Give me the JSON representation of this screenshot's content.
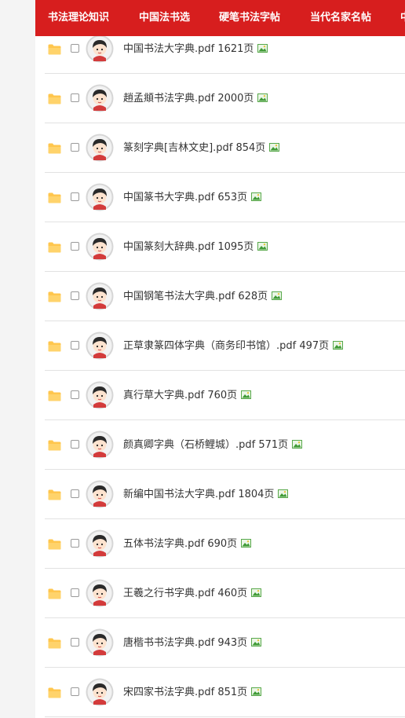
{
  "nav": {
    "tabs": [
      {
        "label": "书法理论知识"
      },
      {
        "label": "中国法书选"
      },
      {
        "label": "硬笔书法字帖"
      },
      {
        "label": "当代名家名帖"
      },
      {
        "label": "中"
      }
    ]
  },
  "files": [
    {
      "name": "中国书法大字典.pdf 1621页"
    },
    {
      "name": "趙孟頫书法字典.pdf 2000页"
    },
    {
      "name": "篆刻字典[吉林文史].pdf 854页"
    },
    {
      "name": "中国篆书大字典.pdf 653页"
    },
    {
      "name": "中国篆刻大辞典.pdf 1095页"
    },
    {
      "name": "中国钢笔书法大字典.pdf 628页"
    },
    {
      "name": "正草隶篆四体字典（商务印书馆）.pdf 497页"
    },
    {
      "name": "真行草大字典.pdf 760页"
    },
    {
      "name": "颜真卿字典（石桥鲤城）.pdf 571页"
    },
    {
      "name": "新编中国书法大字典.pdf 1804页"
    },
    {
      "name": "五体书法字典.pdf 690页"
    },
    {
      "name": "王羲之行书字典.pdf 460页"
    },
    {
      "name": "唐楷书书法字典.pdf 943页"
    },
    {
      "name": "宋四家书法字典.pdf 851页"
    }
  ],
  "colors": {
    "nav_bg": "#d71e1e",
    "folder": "#ffc64d",
    "divider": "#e2e2e2"
  },
  "icons": {
    "row_type": "folder-icon",
    "user": "avatar-icon",
    "attachment": "image-icon"
  }
}
